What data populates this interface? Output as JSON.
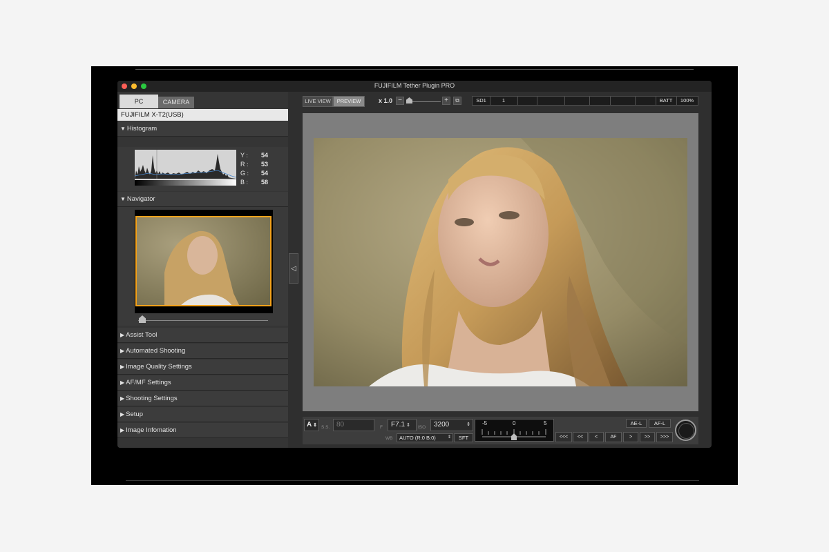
{
  "window": {
    "title": "FUJIFILM Tether Plugin PRO"
  },
  "tabs": [
    {
      "label": "PC"
    },
    {
      "label": "CAMERA"
    }
  ],
  "device": "FUJIFILM X-T2(USB)",
  "sections": {
    "histogram": "Histogram",
    "navigator": "Navigator",
    "collapsed": [
      "Assist Tool",
      "Automated Shooting",
      "Image Quality Settings",
      "AF/MF Settings",
      "Shooting Settings",
      "Setup",
      "Image Infomation"
    ]
  },
  "histogram_stats": [
    {
      "label": "Y :",
      "value": "54"
    },
    {
      "label": "R :",
      "value": "53"
    },
    {
      "label": "G :",
      "value": "54"
    },
    {
      "label": "B :",
      "value": "58"
    }
  ],
  "toolbar": {
    "live_view": "LIVE VIEW",
    "preview": "PREVIEW",
    "zoom": "x 1.0",
    "zoom_minus": "−",
    "zoom_plus": "+",
    "status": {
      "sd": "SD1",
      "count": "1",
      "batt": "BATT",
      "batt_value": "100%"
    }
  },
  "collapse_arrow": "◁",
  "controls": {
    "mode": "A",
    "ss_label": "S.S.",
    "ss_value": "80",
    "f_label": "F",
    "f_value": "F7.1",
    "iso_label": "ISO",
    "iso_value": "3200",
    "wb_label": "WB",
    "wb_value": "AUTO (R:0 B:0)",
    "sft": "SFT",
    "exp_scale": {
      "min": "-5",
      "mid": "0",
      "max": "5"
    },
    "ae_l": "AE-L",
    "af_l": "AF-L",
    "nav": [
      "<<<",
      "<<",
      "<",
      "AF",
      ">",
      ">>",
      ">>>"
    ]
  },
  "colors": {
    "accent_orange": "#f4a21b",
    "panel": "#353535"
  }
}
